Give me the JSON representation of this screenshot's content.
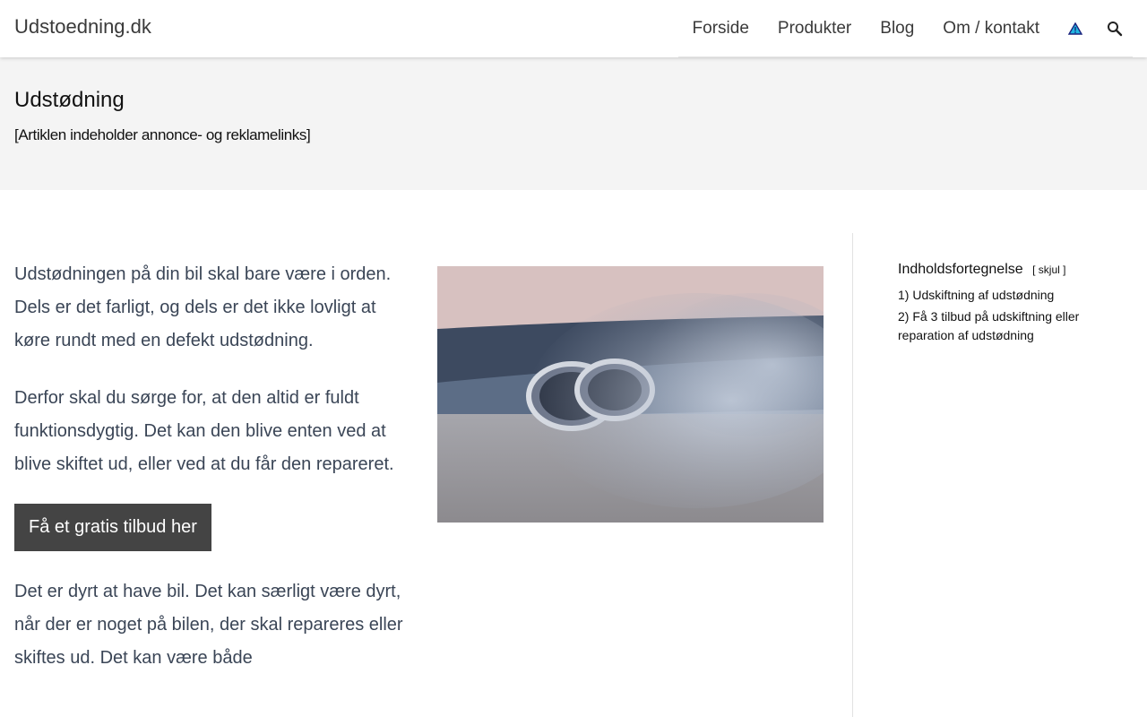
{
  "header": {
    "site_title": "Udstoedning.dk",
    "nav": [
      {
        "label": "Forside"
      },
      {
        "label": "Produkter"
      },
      {
        "label": "Blog"
      },
      {
        "label": "Om / kontakt"
      }
    ],
    "icons": {
      "warning": "warning-icon",
      "search": "search-icon"
    }
  },
  "title_band": {
    "title": "Udstødning",
    "notice": "[Artiklen indeholder annonce- og reklamelinks]"
  },
  "content": {
    "paragraph_1": "Udstødningen på din bil skal bare være i orden. Dels er det farligt, og dels er det ikke lovligt at køre rundt med en defekt udstødning.",
    "paragraph_2": "Derfor skal du sørge for, at den altid er fuldt funktionsdygtig. Det kan den blive enten ved at blive skiftet ud, eller ved at du får den repareret.",
    "cta_label": "Få et gratis tilbud her",
    "paragraph_3": "Det er dyrt at have bil. Det kan særligt være dyrt, når der er noget på bilen, der skal repareres eller skiftes ud. Det kan være både"
  },
  "toc": {
    "title": "Indholdsfortegnelse",
    "toggle_open": "[",
    "toggle_label": "skjul",
    "toggle_close": "]",
    "items": [
      {
        "num": "1)",
        "label": "Udskiftning af udstødning"
      },
      {
        "num": "2)",
        "label": "Få 3 tilbud på udskiftning eller reparation af udstødning"
      }
    ]
  },
  "colors": {
    "warning_fill": "#22b6e0",
    "warning_stroke": "#1a237e",
    "button_bg": "#444444",
    "title_band_bg": "#f4f4f4"
  }
}
